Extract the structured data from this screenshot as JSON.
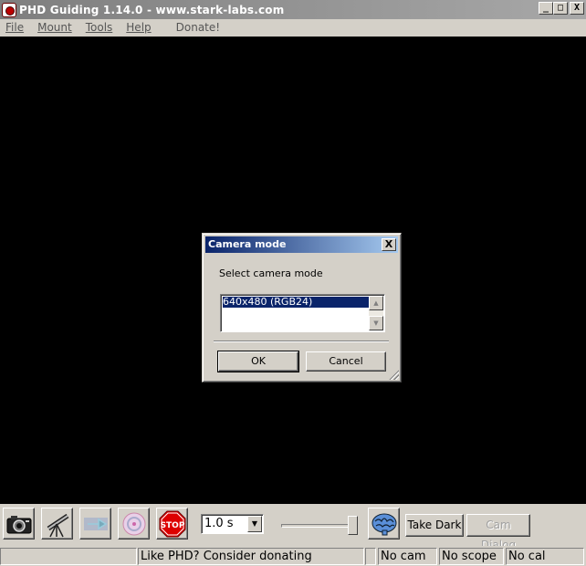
{
  "window": {
    "title": "PHD Guiding 1.14.0  -  www.stark-labs.com",
    "minimize": "_",
    "maximize": "□",
    "close": "X"
  },
  "menu": [
    "File",
    "Mount",
    "Tools",
    "Help",
    "Donate!"
  ],
  "dialog": {
    "title": "Camera mode",
    "close": "X",
    "prompt": "Select camera mode",
    "options": [
      "640x480 (RGB24)"
    ],
    "selected": "640x480 (RGB24)",
    "ok_label": "OK",
    "cancel_label": "Cancel"
  },
  "toolbar": {
    "buttons": [
      "camera-icon",
      "telescope-icon",
      "loop-arrow-icon",
      "guide-target-icon",
      "stop-icon",
      "brain-icon"
    ],
    "exposure": "1.0 s",
    "take_dark_label": "Take Dark",
    "cam_dialog_label": "Cam Dialog",
    "stop_label": "STOP"
  },
  "statusbar": {
    "message": "Like PHD? Consider donating",
    "camera": "No cam",
    "scope": "No scope",
    "calibration": "No cal"
  }
}
